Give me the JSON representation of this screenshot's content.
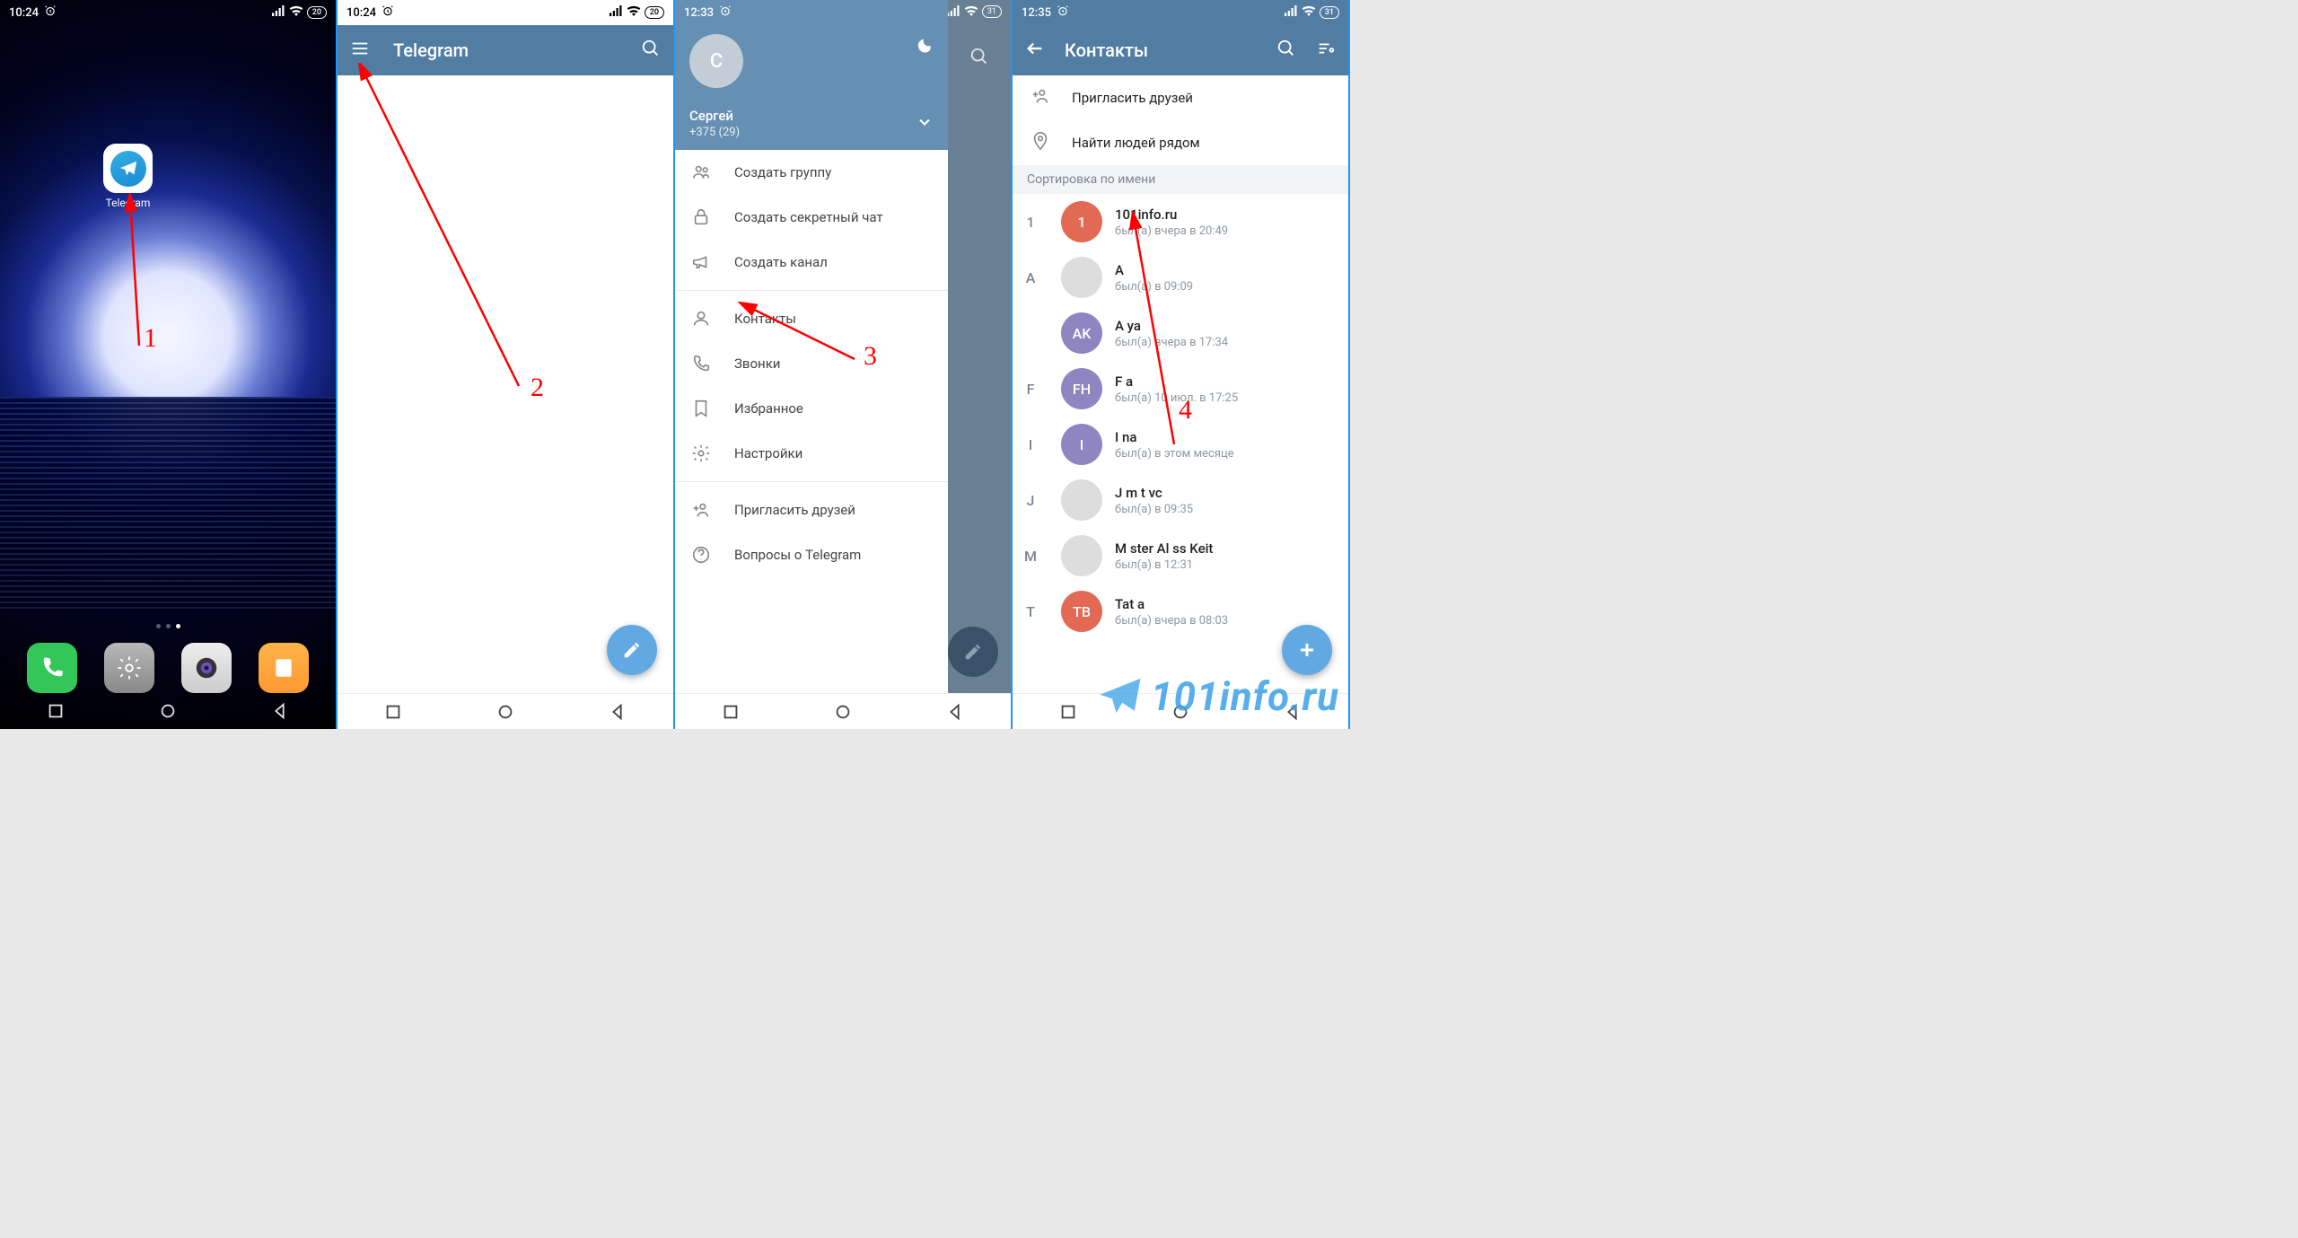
{
  "panels": {
    "p1": {
      "time": "10:24",
      "battery": "20",
      "app_label": "Telegram",
      "anno": "1"
    },
    "p2": {
      "time": "10:24",
      "battery": "20",
      "title": "Telegram",
      "anno": "2"
    },
    "p3": {
      "time": "12:33",
      "battery": "31",
      "user_initial": "С",
      "user_name": "Сергей",
      "user_phone": "+375 (29)",
      "menu": {
        "new_group": "Создать группу",
        "secret_chat": "Создать секретный чат",
        "new_channel": "Создать канал",
        "contacts": "Контакты",
        "calls": "Звонки",
        "saved": "Избранное",
        "settings": "Настройки",
        "invite": "Пригласить друзей",
        "faq": "Вопросы о Telegram"
      },
      "anno": "3"
    },
    "p4": {
      "time": "12:35",
      "battery": "31",
      "title": "Контакты",
      "invite": "Пригласить друзей",
      "nearby": "Найти людей рядом",
      "sort_label": "Сортировка по имени",
      "contacts": [
        {
          "letter": "1",
          "initials": "1",
          "color": "#e26a54",
          "name": "101info.ru",
          "status": "был(а) вчера в 20:49"
        },
        {
          "letter": "A",
          "initials": "",
          "color": "#ddd",
          "name": "A",
          "status": "был(а) в 09:09"
        },
        {
          "letter": "",
          "initials": "AK",
          "color": "#8f85c1",
          "name": "A                  ya",
          "status": "был(а) вчера в 17:34"
        },
        {
          "letter": "F",
          "initials": "FH",
          "color": "#8f85c1",
          "name": "F                    a",
          "status": "был(а) 10 июл. в 17:25"
        },
        {
          "letter": "I",
          "initials": "I",
          "color": "#8f85c1",
          "name": "I   na",
          "status": "был(а) в этом месяце"
        },
        {
          "letter": "J",
          "initials": "",
          "color": "#ddd",
          "name": "J m        t vc",
          "status": "был(а) в 09:35"
        },
        {
          "letter": "M",
          "initials": "",
          "color": "#ddd",
          "name": "M ster    Al ss        Keit",
          "status": "был(а) в 12:31"
        },
        {
          "letter": "T",
          "initials": "ТВ",
          "color": "#e26a54",
          "name": "Tat             a",
          "status": "был(а) вчера в 08:03"
        }
      ],
      "anno": "4"
    }
  },
  "watermark": "101info.ru"
}
